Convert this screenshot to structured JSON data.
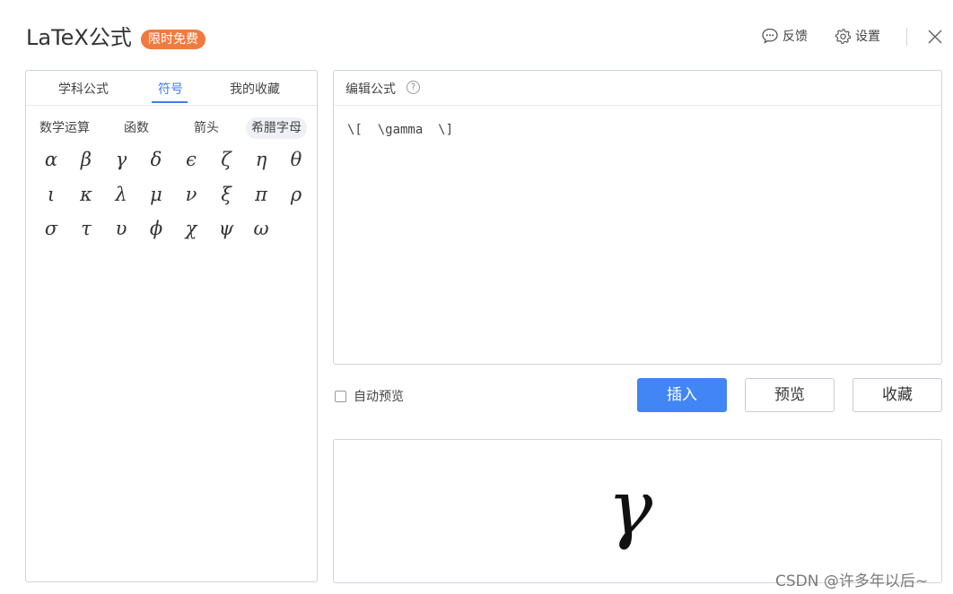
{
  "header": {
    "title": "LaTeX公式",
    "badge": "限时免费",
    "feedback_label": "反馈",
    "settings_label": "设置"
  },
  "tabs": [
    "学科公式",
    "符号",
    "我的收藏"
  ],
  "subtabs": [
    "数学运算",
    "函数",
    "箭头",
    "希腊字母"
  ],
  "symbols": [
    [
      "α",
      "β",
      "γ",
      "δ",
      "ϵ",
      "ζ",
      "η",
      "θ"
    ],
    [
      "ι",
      "κ",
      "λ",
      "μ",
      "ν",
      "ξ",
      "π",
      "ρ"
    ],
    [
      "σ",
      "τ",
      "υ",
      "ϕ",
      "χ",
      "ψ",
      "ω"
    ]
  ],
  "editor": {
    "label": "编辑公式",
    "help": "?",
    "code": "\\[  \\gamma  \\]"
  },
  "controls": {
    "auto_preview_label": "自动预览",
    "insert_label": "插入",
    "preview_label": "预览",
    "favorite_label": "收藏"
  },
  "preview": {
    "rendered": "γ"
  },
  "watermark": "CSDN @许多年以后~",
  "colors": {
    "accent": "#4285f4",
    "tab_active": "#3f7ef2",
    "badge": "#f07b3f"
  }
}
